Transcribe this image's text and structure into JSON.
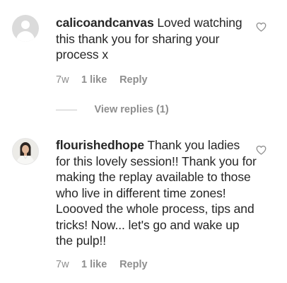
{
  "comments": [
    {
      "username": "calicoandcanvas",
      "text": "Loved watching this thank you for sharing your process x",
      "avatar": "default-avatar-icon",
      "time": "7w",
      "likes": "1 like",
      "reply_label": "Reply",
      "view_replies": "View replies (1)"
    },
    {
      "username": "flourishedhope",
      "text": "Thank you ladies for this lovely session!! Thank you for making the replay available to those who live in different time zones! Loooved the whole process, tips and tricks! Now... let's go and wake up the pulp!!",
      "avatar": "profile-photo",
      "time": "7w",
      "likes": "1 like",
      "reply_label": "Reply"
    }
  ],
  "colors": {
    "text": "#262626",
    "secondary": "#8e8e8e",
    "divider": "#c7c7c7",
    "avatar_placeholder": "#dbdbdb"
  },
  "icons": {
    "like": "heart-outline-icon"
  }
}
